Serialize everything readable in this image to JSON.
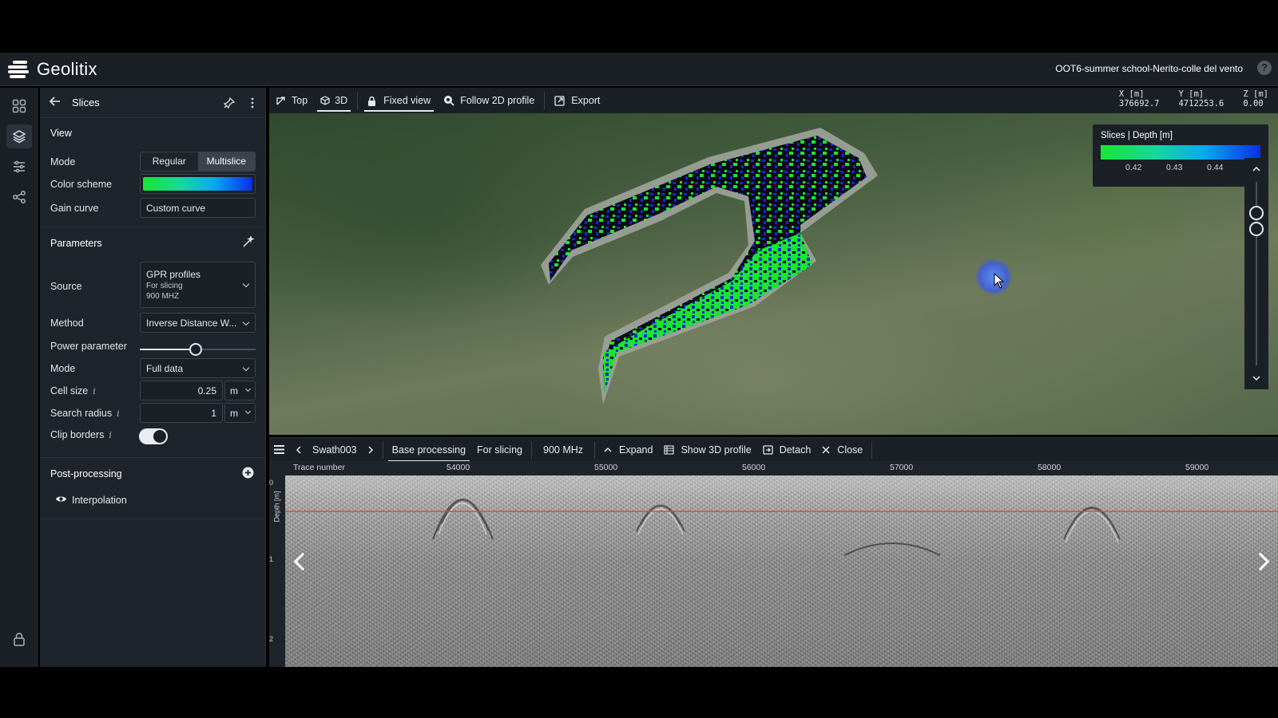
{
  "app": {
    "name": "Geolitix",
    "project": "OOT6-summer school-Nerito-colle del vento"
  },
  "panel": {
    "title": "Slices",
    "view": {
      "section": "View",
      "mode_label": "Mode",
      "mode_options": [
        "Regular",
        "Multislice"
      ],
      "mode_selected": "Multislice",
      "color_scheme_label": "Color scheme",
      "gain_curve_label": "Gain curve",
      "gain_curve_value": "Custom curve"
    },
    "parameters": {
      "section": "Parameters",
      "source_label": "Source",
      "source_line1": "GPR profiles",
      "source_line2": "For slicing",
      "source_line3": "900 MHZ",
      "method_label": "Method",
      "method_value": "Inverse Distance W...",
      "power_label": "Power parameter",
      "power_fraction": 0.48,
      "mode_label": "Mode",
      "mode_value": "Full data",
      "cell_size_label": "Cell size",
      "cell_size_value": "0.25",
      "cell_size_unit": "m",
      "search_radius_label": "Search radius",
      "search_radius_value": "1",
      "search_radius_unit": "m",
      "clip_borders_label": "Clip borders",
      "clip_borders_on": true,
      "info_glyph": "i"
    },
    "post_processing": {
      "section": "Post-processing",
      "items": [
        "Interpolation"
      ]
    }
  },
  "toolbar3d": {
    "top": "Top",
    "threed": "3D",
    "fixed_view": "Fixed view",
    "follow": "Follow 2D profile",
    "export": "Export"
  },
  "coords": {
    "x_label": "X [m]",
    "x_value": "376692.7",
    "y_label": "Y [m]",
    "y_value": "4712253.6",
    "z_label": "Z [m]",
    "z_value": "0.00"
  },
  "legend": {
    "title": "Slices | Depth [m]",
    "ticks": [
      "0.42",
      "0.43",
      "0.44"
    ]
  },
  "profile": {
    "swath": "Swath003",
    "tabs": [
      "Base processing",
      "For slicing"
    ],
    "active_tab": "Base processing",
    "frequency": "900 MHz",
    "expand": "Expand",
    "show3d": "Show 3D profile",
    "detach": "Detach",
    "close": "Close",
    "trace_label": "Trace number",
    "trace_ticks": [
      "54000",
      "55000",
      "56000",
      "57000",
      "58000",
      "59000"
    ],
    "depth_label": "Depth [m]",
    "depth_ticks": [
      "0",
      "1",
      "2"
    ]
  },
  "colors": {
    "accent_green": "#19e62f",
    "accent_blue": "#0a2ee6",
    "panel_bg": "#1e242b"
  },
  "icons": [
    "grid-icon",
    "layers-icon",
    "sliders-icon",
    "share-icon",
    "lock-icon",
    "back-arrow-icon",
    "pin-icon",
    "more-icon",
    "wand-icon",
    "plus-circle-icon",
    "eye-icon"
  ]
}
